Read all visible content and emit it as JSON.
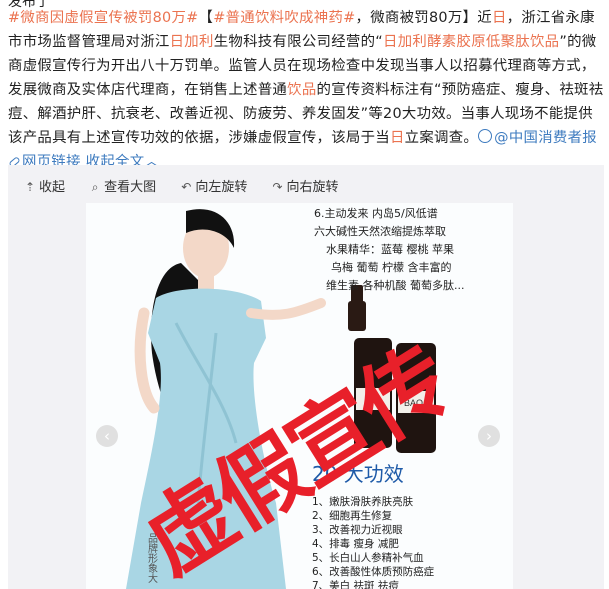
{
  "post": {
    "cut_top_text": "发布了",
    "hashtag1": "#微商因虚假宣传被罚80万#",
    "bracket_open": "【",
    "hashtag2": "#普通饮料吹成神药#",
    "headline_rest": "，微商被罚80万】近",
    "day1": "日",
    "text_a": "，浙江省永康市市场监督管理局对浙江",
    "company_keyword": "日加利",
    "text_b": "生物科技有限公司经营的“",
    "product_keyword": "日加利酵素胶原低聚肽饮品",
    "text_c": "”的微商虚假宣传行为开出八十万罚单。监管人员在现场检查中发现当事人以招募代理商等方式，发展微商及实体店代理商，在销售上述普通",
    "drink_keyword": "饮品",
    "text_d": "的宣传资料标注有“预防癌症、瘦身、祛斑祛痘、解酒护肝、抗衰老、改善近视、防疲劳、养发固发”等20大功效。当事人现场不能提供该产品具有上述宣传功效的依据，涉嫌虚假宣传，该局于当",
    "day2": "日",
    "text_e": "立案调查。",
    "source_link": "@中国消费者报",
    "weblink_label": "网页链接",
    "collapse_label": "收起全文",
    "collapse_caret": "︿"
  },
  "toolbar": {
    "collapse": "收起",
    "view_large": "查看大图",
    "rotate_left": "向左旋转",
    "rotate_right": "向右旋转"
  },
  "image": {
    "top_list": [
      "6.主动发来 内岛5/风低谱",
      "六大碱性天然浓缩提炼萃取",
      "水果精华：蓝莓 樱桃 苹果",
      "乌梅 葡萄 柠檬 含丰富的",
      "维生素 各种机酸 葡萄多肽..."
    ],
    "heading": "20 大功效",
    "benefits": [
      "1、嫩肤滑肤养肤亮肤",
      "2、细胞再生修复",
      "3、改善视力近视眼",
      "4、排毒 瘦身 减肥",
      "5、长白山人参精补气血",
      "6、改善酸性体质预防癌症",
      "7、美白 祛斑 祛痘"
    ],
    "stamp": "虚假宣传",
    "side_text": "品牌形象大",
    "bottle_label": "BAOA"
  },
  "colors": {
    "hashtag": "#eb7350",
    "link": "#3e7bbf",
    "stamp": "#e8202a",
    "dress": "#a9d6e4"
  }
}
